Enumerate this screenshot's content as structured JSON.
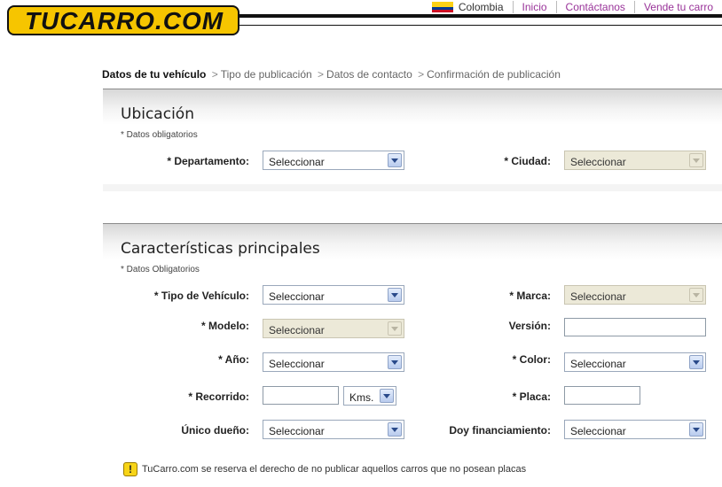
{
  "header": {
    "logo_text": "TUCARRO.COM",
    "country": "Colombia",
    "nav": [
      "Inicio",
      "Contáctanos",
      "Vende tu carro"
    ]
  },
  "breadcrumb": {
    "current": "Datos de tu vehículo",
    "steps": [
      "Tipo de publicación",
      "Datos de contacto",
      "Confirmación de publicación"
    ],
    "separator": ">"
  },
  "ubicacion": {
    "title": "Ubicación",
    "note": "* Datos obligatorios",
    "departamento": {
      "label": "* Departamento:",
      "value": "Seleccionar"
    },
    "ciudad": {
      "label": "* Ciudad:",
      "value": "Seleccionar"
    }
  },
  "caracteristicas": {
    "title": "Características principales",
    "note": "* Datos Obligatorios",
    "tipo": {
      "label": "* Tipo de Vehículo:",
      "value": "Seleccionar"
    },
    "marca": {
      "label": "* Marca:",
      "value": "Seleccionar"
    },
    "modelo": {
      "label": "* Modelo:",
      "value": "Seleccionar"
    },
    "version": {
      "label": "Versión:",
      "value": ""
    },
    "anio": {
      "label": "* Año:",
      "value": "Seleccionar"
    },
    "color": {
      "label": "* Color:",
      "value": "Seleccionar"
    },
    "recorrido": {
      "label": "* Recorrido:",
      "value": "",
      "unit": "Kms."
    },
    "placa": {
      "label": "* Placa:",
      "value": ""
    },
    "unico": {
      "label": "Único dueño:",
      "value": "Seleccionar"
    },
    "financiamiento": {
      "label": "Doy financiamiento:",
      "value": "Seleccionar"
    }
  },
  "notice": {
    "icon": "warning-icon",
    "text": "TuCarro.com se reserva el derecho de no publicar aquellos carros que no posean placas"
  },
  "colors": {
    "accent": "#993399",
    "logo": "#f6c500"
  }
}
